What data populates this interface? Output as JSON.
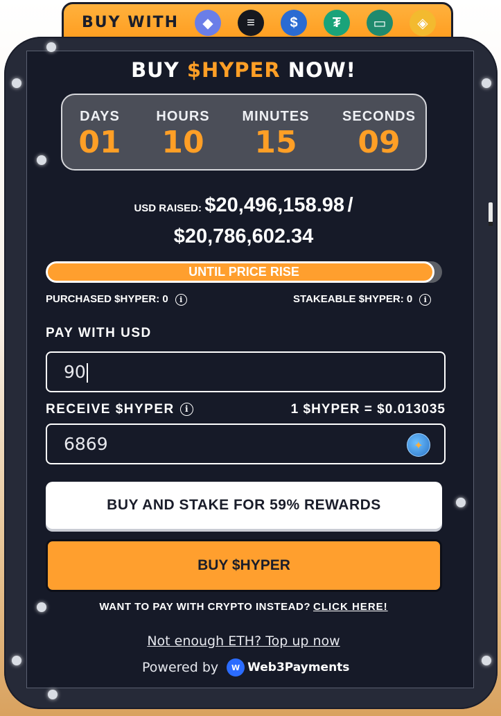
{
  "tabbar": {
    "label": "BUY WITH",
    "methods": [
      {
        "name": "ethereum-icon",
        "glyph": "◆",
        "color": "#6a7ee8"
      },
      {
        "name": "solana-icon",
        "glyph": "≡",
        "color": "#16181f"
      },
      {
        "name": "usdc-icon",
        "glyph": "$",
        "color": "#2a6bd2"
      },
      {
        "name": "tether-icon",
        "glyph": "₮",
        "color": "#1aa37a"
      },
      {
        "name": "card-icon",
        "glyph": "▭",
        "color": "#1f8a6e"
      },
      {
        "name": "bnb-icon",
        "glyph": "◈",
        "color": "#f3ba2f"
      }
    ]
  },
  "header": {
    "title_before": "BUY ",
    "title_token": "$HYPER",
    "title_after": " NOW!"
  },
  "countdown": [
    {
      "label": "DAYS",
      "value": "01"
    },
    {
      "label": "HOURS",
      "value": "10"
    },
    {
      "label": "MINUTES",
      "value": "15"
    },
    {
      "label": "SECONDS",
      "value": "09"
    }
  ],
  "raised": {
    "label": "USD RAISED:",
    "current": "$20,496,158.98",
    "separator": "/",
    "target": "$20,786,602.34"
  },
  "progress": {
    "text": "UNTIL PRICE RISE",
    "fill_fraction": 0.98
  },
  "stats": {
    "purchased": "PURCHASED $HYPER: 0",
    "stakeable": "STAKEABLE $HYPER: 0",
    "info_glyph": "i"
  },
  "pay": {
    "label": "PAY WITH USD",
    "value": "90"
  },
  "receive": {
    "label": "RECEIVE $HYPER",
    "rate": "1 $HYPER = $0.013035",
    "value": "6869"
  },
  "buttons": {
    "stake": "BUY AND STAKE FOR 59% REWARDS",
    "buy": "BUY $HYPER"
  },
  "footer": {
    "crypto_prompt": "WANT TO PAY WITH CRYPTO INSTEAD?",
    "crypto_link": "CLICK HERE!",
    "topup": "Not enough ETH? Top up now",
    "powered_by": "Powered by",
    "provider": "Web3Payments",
    "provider_logo": "W"
  },
  "colors": {
    "accent": "#ff9f26",
    "panel": "#161a28",
    "frame": "#262a38"
  }
}
